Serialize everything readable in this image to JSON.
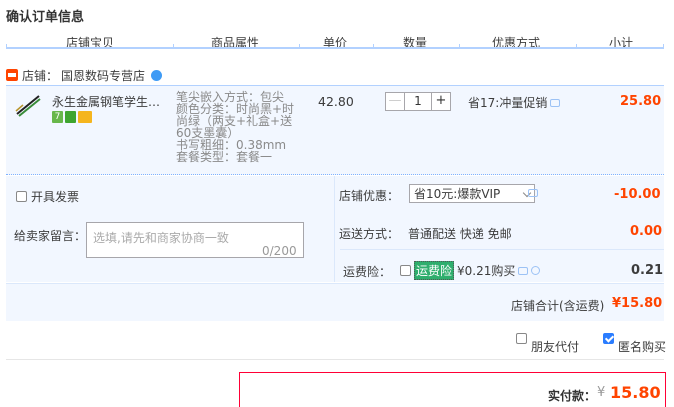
{
  "page_title": "确认订单信息",
  "columns": [
    "店铺宝贝",
    "商品属性",
    "单价",
    "数量",
    "优惠方式",
    "小计"
  ],
  "shop": {
    "label": "店铺：",
    "name": "国恩数码专营店"
  },
  "item": {
    "title": "永生金属钢笔学生用...",
    "attrs": [
      "笔尖嵌入方式：包尖",
      "颜色分类：时尚黑+时",
      "尚绿（两支+礼盒+送",
      "60支墨囊）",
      "书写粗细：0.38mm",
      "套餐类型：套餐一"
    ],
    "badge_7": "7",
    "price": "42.80",
    "qty_minus": "—",
    "qty": "1",
    "qty_plus": "+",
    "promo": "省17:冲量促销",
    "subtotal": "25.80"
  },
  "invoice_label": "开具发票",
  "message": {
    "label": "给卖家留言：",
    "placeholder": "选填,请先和商家协商一致",
    "count": "0/200"
  },
  "discount": {
    "label": "店铺优惠：",
    "selected": "省10元:爆款VIP",
    "value": "-10.00"
  },
  "shipping": {
    "label": "运送方式：",
    "text": "普通配送 快递 免邮",
    "value": "0.00"
  },
  "insurance": {
    "label": "运费险：",
    "tag": "运费险",
    "price_text": "¥0.21购买",
    "value": "0.21"
  },
  "total": {
    "label": "店铺合计(含运费)",
    "value": "¥15.80"
  },
  "friend_pay": "朋友代付",
  "anonymous": "匿名购买",
  "payment": {
    "label": "实付款：",
    "symbol": "¥",
    "value": "15.80"
  },
  "colors": {
    "accent": "#ff4400",
    "panel": "#f2f7ff",
    "header_line": "#b2d1ff"
  },
  "icons": [
    "shop-icon",
    "wangwang-icon",
    "tip-bubble-icon",
    "help-icon",
    "checkbox-icon",
    "caret-down-icon"
  ]
}
